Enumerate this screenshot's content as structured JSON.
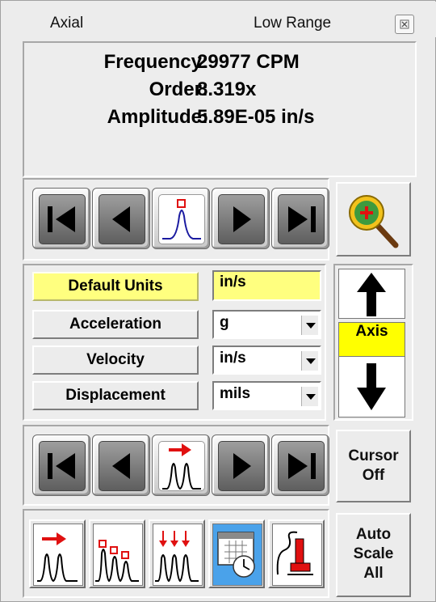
{
  "titlebar": {
    "left_label": "Axial",
    "right_label": "Low Range"
  },
  "readout": {
    "frequency_label": "Frequency:",
    "frequency_value": "29977 CPM",
    "order_label": "Order:",
    "order_value": "8.319x",
    "amplitude_label": "Amplitude:",
    "amplitude_value": "5.89E-05 in/s"
  },
  "units": {
    "default_label": "Default Units",
    "default_value": "in/s",
    "accel_label": "Acceleration",
    "accel_value": "g",
    "velocity_label": "Velocity",
    "velocity_value": "in/s",
    "displacement_label": "Displacement",
    "displacement_value": "mils"
  },
  "axis": {
    "label": "Axis"
  },
  "cursor": {
    "line1": "Cursor",
    "line2": "Off"
  },
  "autoscale": {
    "line1": "Auto",
    "line2": "Scale",
    "line3": "All"
  },
  "colors": {
    "highlight_yellow": "#ffff7f",
    "axis_yellow": "#ffff00",
    "peak_blue": "#1a1aa0",
    "marker_red": "#e01010",
    "calendar_blue": "#4aa2ea"
  },
  "icons": [
    "close-icon",
    "first-icon",
    "prev-icon",
    "peak-icon",
    "next-icon",
    "last-icon",
    "zoom-icon",
    "up-arrow-icon",
    "down-arrow-icon",
    "harmonic-arrow-icon",
    "harmonic-markers-icon",
    "harmonic-down-arrows-icon",
    "calendar-clock-icon",
    "trend-icon"
  ]
}
